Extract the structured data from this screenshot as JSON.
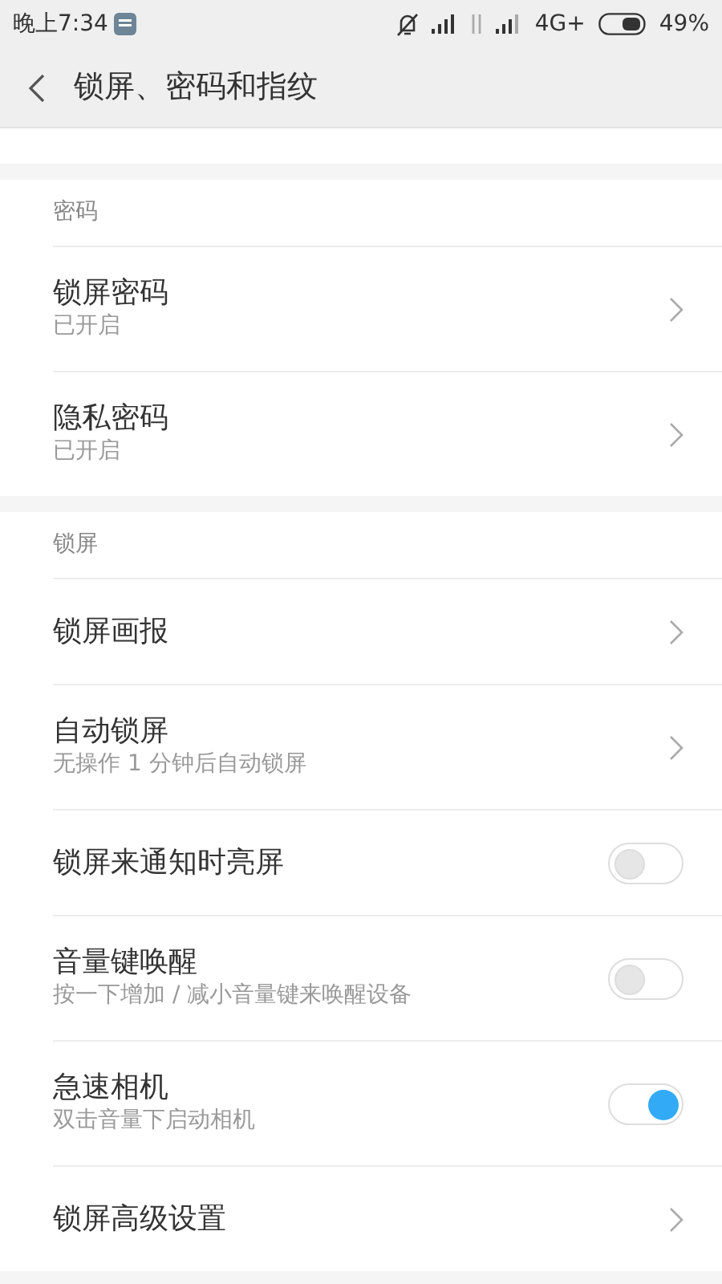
{
  "status_bar": {
    "time": "晚上7:34",
    "network": "4G+",
    "battery": "49%"
  },
  "header": {
    "title": "锁屏、密码和指纹"
  },
  "sections": [
    {
      "title": "密码",
      "rows": [
        {
          "kind": "link",
          "title": "锁屏密码",
          "subtitle": "已开启"
        },
        {
          "kind": "link",
          "title": "隐私密码",
          "subtitle": "已开启"
        }
      ]
    },
    {
      "title": "锁屏",
      "rows": [
        {
          "kind": "link",
          "title": "锁屏画报"
        },
        {
          "kind": "link",
          "title": "自动锁屏",
          "subtitle": "无操作 1 分钟后自动锁屏"
        },
        {
          "kind": "toggle",
          "title": "锁屏来通知时亮屏",
          "on": false
        },
        {
          "kind": "toggle",
          "title": "音量键唤醒",
          "subtitle": "按一下增加 / 减小音量键来唤醒设备",
          "on": false
        },
        {
          "kind": "toggle",
          "title": "急速相机",
          "subtitle": "双击音量下启动相机",
          "on": true
        },
        {
          "kind": "link",
          "title": "锁屏高级设置"
        }
      ]
    }
  ]
}
